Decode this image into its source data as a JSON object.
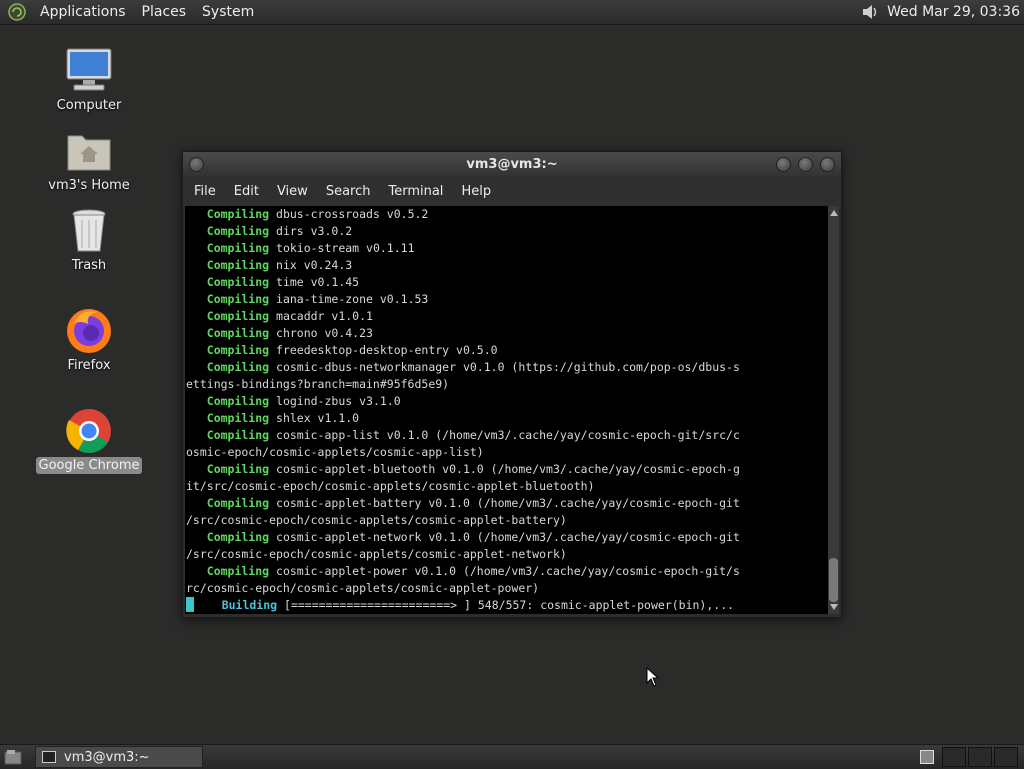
{
  "top_panel": {
    "menus": [
      "Applications",
      "Places",
      "System"
    ],
    "clock": "Wed Mar 29, 03:36",
    "volume_icon": "speaker-icon"
  },
  "desktop_icons": [
    {
      "label": "Computer",
      "icon": "computer-icon"
    },
    {
      "label": "vm3's Home",
      "icon": "home-folder-icon"
    },
    {
      "label": "Trash",
      "icon": "trash-icon"
    },
    {
      "label": "Firefox",
      "icon": "firefox-icon"
    },
    {
      "label": "Google Chrome",
      "icon": "chrome-icon",
      "selected": true
    }
  ],
  "terminal": {
    "title": "vm3@vm3:~",
    "menus": [
      "File",
      "Edit",
      "View",
      "Search",
      "Terminal",
      "Help"
    ],
    "lines": [
      {
        "kw": "   Compiling",
        "text": " dbus-crossroads v0.5.2"
      },
      {
        "kw": "   Compiling",
        "text": " dirs v3.0.2"
      },
      {
        "kw": "   Compiling",
        "text": " tokio-stream v0.1.11"
      },
      {
        "kw": "   Compiling",
        "text": " nix v0.24.3"
      },
      {
        "kw": "   Compiling",
        "text": " time v0.1.45"
      },
      {
        "kw": "   Compiling",
        "text": " iana-time-zone v0.1.53"
      },
      {
        "kw": "   Compiling",
        "text": " macaddr v1.0.1"
      },
      {
        "kw": "   Compiling",
        "text": " chrono v0.4.23"
      },
      {
        "kw": "   Compiling",
        "text": " freedesktop-desktop-entry v0.5.0"
      },
      {
        "kw": "   Compiling",
        "text": " cosmic-dbus-networkmanager v0.1.0 (https://github.com/pop-os/dbus-s"
      },
      {
        "kw": "",
        "text": "ettings-bindings?branch=main#95f6d5e9)"
      },
      {
        "kw": "   Compiling",
        "text": " logind-zbus v3.1.0"
      },
      {
        "kw": "   Compiling",
        "text": " shlex v1.1.0"
      },
      {
        "kw": "   Compiling",
        "text": " cosmic-app-list v0.1.0 (/home/vm3/.cache/yay/cosmic-epoch-git/src/c"
      },
      {
        "kw": "",
        "text": "osmic-epoch/cosmic-applets/cosmic-app-list)"
      },
      {
        "kw": "   Compiling",
        "text": " cosmic-applet-bluetooth v0.1.0 (/home/vm3/.cache/yay/cosmic-epoch-g"
      },
      {
        "kw": "",
        "text": "it/src/cosmic-epoch/cosmic-applets/cosmic-applet-bluetooth)"
      },
      {
        "kw": "   Compiling",
        "text": " cosmic-applet-battery v0.1.0 (/home/vm3/.cache/yay/cosmic-epoch-git"
      },
      {
        "kw": "",
        "text": "/src/cosmic-epoch/cosmic-applets/cosmic-applet-battery)"
      },
      {
        "kw": "   Compiling",
        "text": " cosmic-applet-network v0.1.0 (/home/vm3/.cache/yay/cosmic-epoch-git"
      },
      {
        "kw": "",
        "text": "/src/cosmic-epoch/cosmic-applets/cosmic-applet-network)"
      },
      {
        "kw": "   Compiling",
        "text": " cosmic-applet-power v0.1.0 (/home/vm3/.cache/yay/cosmic-epoch-git/s"
      },
      {
        "kw": "",
        "text": "rc/cosmic-epoch/cosmic-applets/cosmic-applet-power)"
      }
    ],
    "building": {
      "kw": "    Building",
      "text": " [=======================> ] 548/557: cosmic-applet-power(bin),..."
    }
  },
  "taskbar": {
    "task_label": "vm3@vm3:~"
  }
}
